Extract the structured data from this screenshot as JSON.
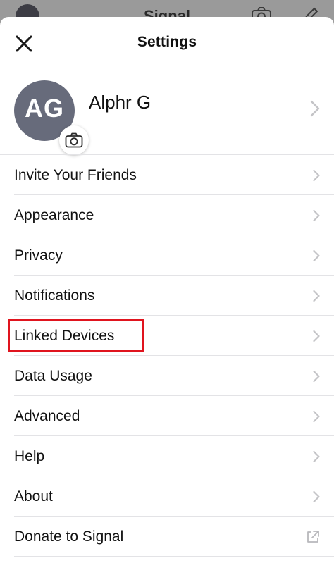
{
  "background_app": {
    "title": "Signal"
  },
  "header": {
    "title": "Settings"
  },
  "profile": {
    "initials": "AG",
    "name": "Alphr G"
  },
  "menu": [
    {
      "label": "Invite Your Friends",
      "icon": "chevron-right-icon"
    },
    {
      "label": "Appearance",
      "icon": "chevron-right-icon"
    },
    {
      "label": "Privacy",
      "icon": "chevron-right-icon"
    },
    {
      "label": "Notifications",
      "icon": "chevron-right-icon"
    },
    {
      "label": "Linked Devices",
      "icon": "chevron-right-icon",
      "highlighted": true
    },
    {
      "label": "Data Usage",
      "icon": "chevron-right-icon"
    },
    {
      "label": "Advanced",
      "icon": "chevron-right-icon"
    },
    {
      "label": "Help",
      "icon": "chevron-right-icon"
    },
    {
      "label": "About",
      "icon": "chevron-right-icon"
    },
    {
      "label": "Donate to Signal",
      "icon": "external-link-icon"
    }
  ],
  "colors": {
    "highlight": "#e0141e",
    "avatar": "#676b7b",
    "divider": "#e3e3e6",
    "chevron": "#c4c4c7"
  }
}
